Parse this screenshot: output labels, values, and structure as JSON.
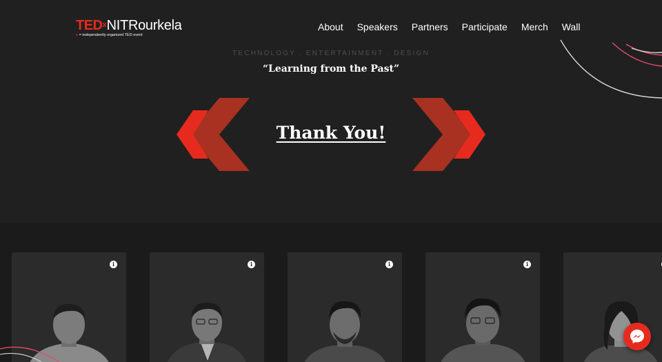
{
  "brand": {
    "ted": "TED",
    "x": "x",
    "name": "NITRourkela",
    "sub_x": "x",
    "sub_text": " = independently organized TED event"
  },
  "nav": {
    "items": [
      "About",
      "Speakers",
      "Partners",
      "Participate",
      "Merch",
      "Wall"
    ]
  },
  "hero": {
    "tagline": "TECHNOLOGY . ENTERTAINMENT . DESIGN",
    "theme": "“Learning from the Past”",
    "headline": "Thank You!"
  },
  "cards": {
    "info_glyph": "i",
    "count": 5
  },
  "colors": {
    "accent": "#e62b1e",
    "accent_dark": "#a83122",
    "hero_bg": "#202020",
    "card_bg": "#2b2b2b"
  }
}
